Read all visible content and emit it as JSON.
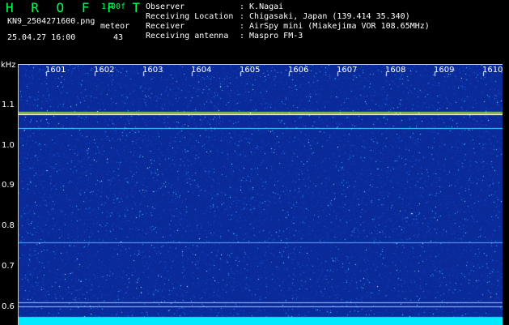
{
  "header": {
    "brand": "H R O F F T",
    "version": "1.00f",
    "filename": "KN9_2504271600.png",
    "meteor_label": "meteor",
    "meteor_count": "43",
    "timestamp": "25.04.27 16:00"
  },
  "info": [
    {
      "label": "Observer",
      "value": ": K.Nagai"
    },
    {
      "label": "Receiving Location",
      "value": ": Chigasaki, Japan (139.414 35.340)"
    },
    {
      "label": "Receiver",
      "value": ": AirSpy mini (Miakejima VOR 108.65MHz)"
    },
    {
      "label": "Receiving antenna",
      "value": ": Maspro FM-3"
    }
  ],
  "spectrogram": {
    "y_unit": "kHz",
    "y_ticks": [
      "1.1",
      "1.0",
      "0.9",
      "0.8",
      "0.7",
      "0.6"
    ],
    "x_ticks": [
      "1601",
      "1602",
      "1603",
      "1604",
      "1605",
      "1606",
      "1607",
      "1608",
      "1609",
      "1610"
    ],
    "colors": {
      "background": "#0a2a9a",
      "signal": "#ffffa0",
      "noise_hot": "#00e0ff",
      "base_band": "#00eaff"
    }
  }
}
